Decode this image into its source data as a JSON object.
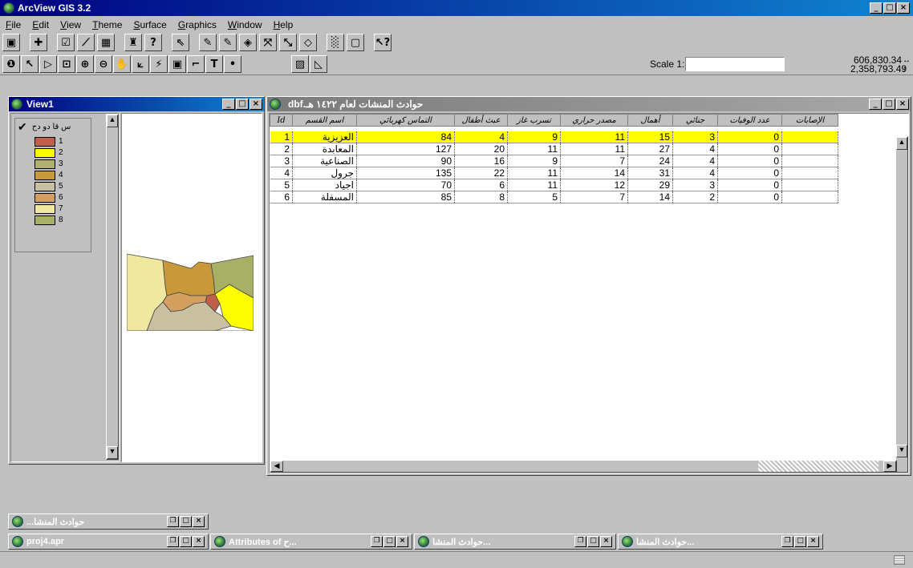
{
  "app": {
    "title": "ArcView GIS 3.2"
  },
  "menu": [
    {
      "pre": "",
      "u": "F",
      "post": "ile"
    },
    {
      "pre": "",
      "u": "E",
      "post": "dit"
    },
    {
      "pre": "",
      "u": "V",
      "post": "iew"
    },
    {
      "pre": "",
      "u": "T",
      "post": "heme"
    },
    {
      "pre": "",
      "u": "S",
      "post": "urface"
    },
    {
      "pre": "",
      "u": "G",
      "post": "raphics"
    },
    {
      "pre": "",
      "u": "W",
      "post": "indow"
    },
    {
      "pre": "",
      "u": "H",
      "post": "elp"
    }
  ],
  "toolbar": {
    "scale_label": "Scale 1:",
    "scale_value": "",
    "coord_x": "606,830.34",
    "coord_y": "2,358,793.49"
  },
  "view": {
    "title": "View1",
    "layer_name": "س قا دو دح",
    "legend": [
      {
        "label": "1",
        "color": "#c0604a"
      },
      {
        "label": "2",
        "color": "#ffff00"
      },
      {
        "label": "3",
        "color": "#b0b070"
      },
      {
        "label": "4",
        "color": "#c8983a"
      },
      {
        "label": "5",
        "color": "#c8c0a0"
      },
      {
        "label": "6",
        "color": "#d4a060"
      },
      {
        "label": "7",
        "color": "#f0e8a0"
      },
      {
        "label": "8",
        "color": "#a8b068"
      }
    ]
  },
  "table": {
    "title": "حوادث المنشات لعام ١٤٢٢ هـ.dbf",
    "columns": [
      "Id",
      "اسم القسم",
      "التماس كهربائي",
      "عبث أطفال",
      "تسرب غاز",
      "مصدر حراري",
      "أهمال",
      "جنائي",
      "عدد الوفيات",
      "الإصابات"
    ],
    "rows": [
      [
        "1",
        "العزيزية",
        "84",
        "4",
        "9",
        "11",
        "15",
        "3",
        "0",
        ""
      ],
      [
        "2",
        "المعابدة",
        "127",
        "20",
        "11",
        "11",
        "27",
        "4",
        "0",
        ""
      ],
      [
        "3",
        "الصناعية",
        "90",
        "16",
        "9",
        "7",
        "24",
        "4",
        "0",
        ""
      ],
      [
        "4",
        "جرول",
        "135",
        "22",
        "11",
        "14",
        "31",
        "4",
        "0",
        ""
      ],
      [
        "5",
        "اجياد",
        "70",
        "6",
        "11",
        "12",
        "29",
        "3",
        "0",
        ""
      ],
      [
        "6",
        "المسفلة",
        "85",
        "8",
        "5",
        "7",
        "14",
        "2",
        "0",
        ""
      ]
    ],
    "selected_row": 0
  },
  "minimized": {
    "single": "حوادث المنشا...",
    "taskbar": [
      "proj4.apr",
      "Attributes of ح...",
      "حوادث المنشا...",
      "حوادث المنشا..."
    ]
  }
}
